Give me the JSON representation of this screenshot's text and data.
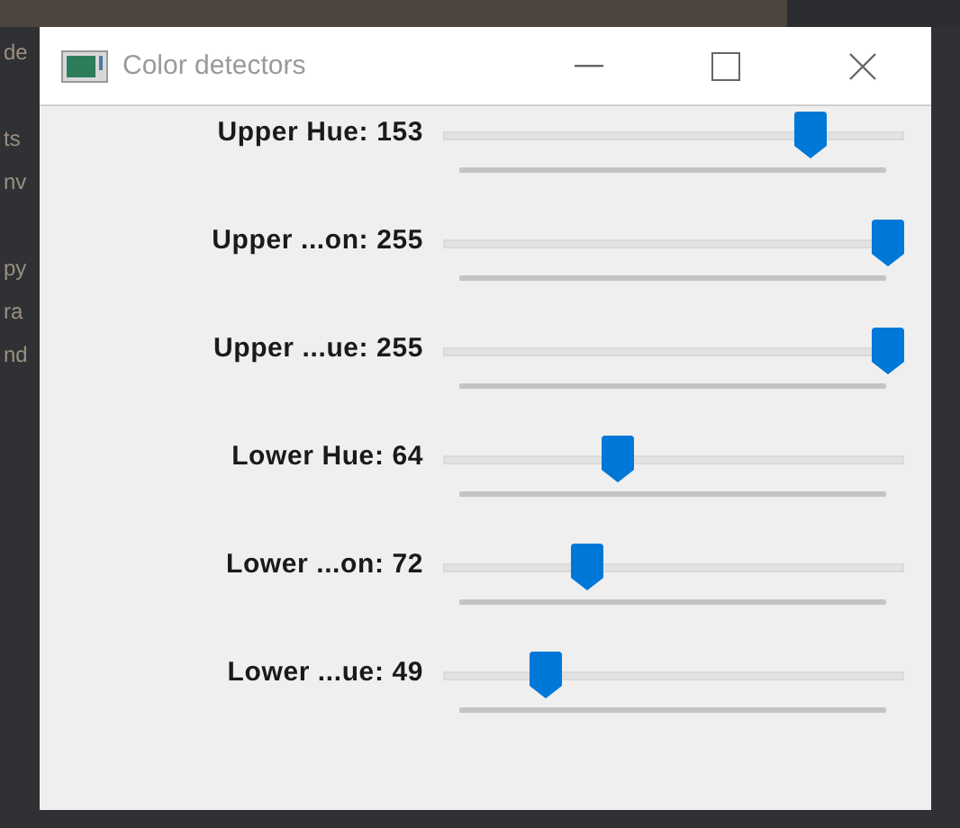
{
  "background_fragments": [
    "de",
    "ts",
    "nv",
    "py",
    "ra",
    "nd"
  ],
  "window": {
    "title": "Color detectors"
  },
  "trackbars": [
    {
      "label": "Upper Hue: 153",
      "level": 0.82
    },
    {
      "label": "Upper ...on: 255",
      "level": 1.0
    },
    {
      "label": "Upper ...ue: 255",
      "level": 1.0
    },
    {
      "label": "Lower Hue: 64",
      "level": 0.37
    },
    {
      "label": "Lower ...on: 72",
      "level": 0.3
    },
    {
      "label": "Lower ...ue: 49",
      "level": 0.2
    }
  ]
}
